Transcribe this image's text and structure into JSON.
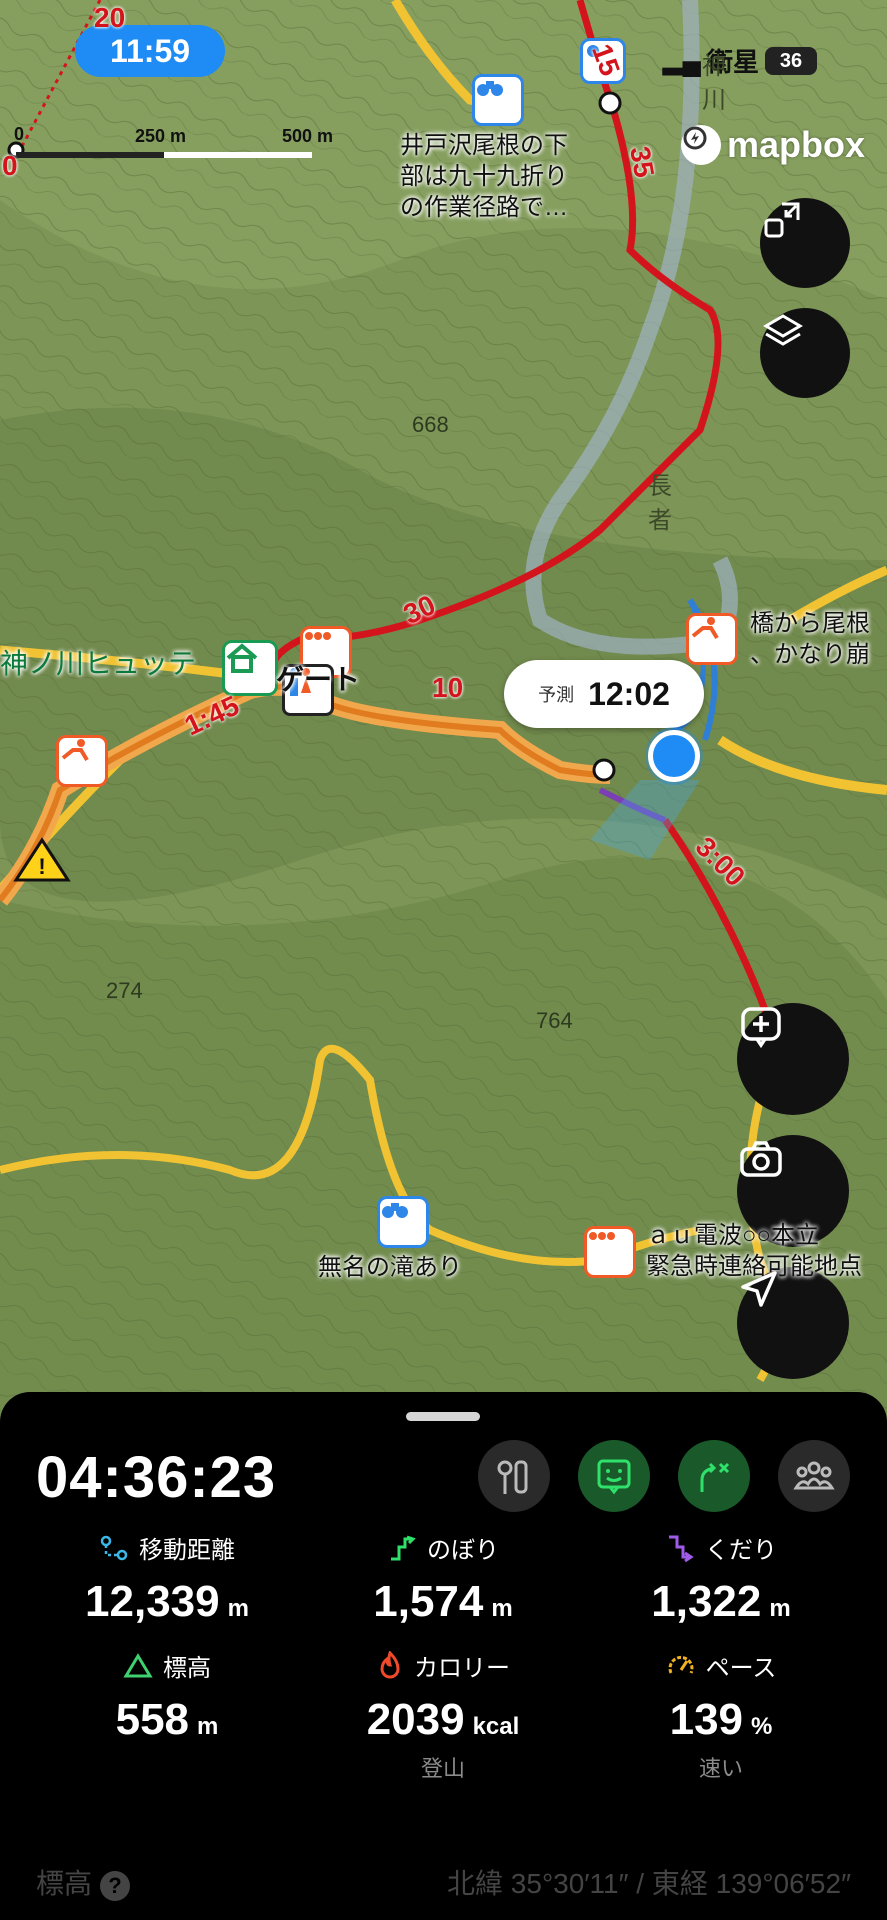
{
  "status_bar": {
    "time": "11:59",
    "carrier": "衛星",
    "battery": "36"
  },
  "scale": {
    "zero": "0",
    "mid": "250 m",
    "end": "500 m"
  },
  "attribution": "mapbox",
  "map": {
    "labels": {
      "idosawa": "井戸沢尾根の下\n部は九十九折り\nの作業径路で…",
      "hutte": "神ノ川ヒュッテ",
      "gate": "ゲート",
      "bridge": "橋から尾根\n、かなり崩",
      "waterfall": "無名の滝あり",
      "au": "ａｕ電波○○本立\n緊急時連絡可能地点"
    },
    "contour_labels": {
      "c668": "668",
      "c274": "274",
      "c764": "764",
      "river": "神\n川",
      "naga": "長\n者"
    },
    "route_marks": {
      "m20": "20",
      "m0": "0",
      "m15": "15",
      "m35": "35",
      "m30": "30",
      "m10": "10",
      "m145": "1:45",
      "m300": "3:00"
    },
    "forecast": {
      "label": "予測",
      "time": "12:02"
    }
  },
  "panel": {
    "elapsed": "04:36:23",
    "stats": {
      "distance": {
        "label": "移動距離",
        "value": "12,339",
        "unit": "m"
      },
      "ascent": {
        "label": "のぼり",
        "value": "1,574",
        "unit": "m"
      },
      "descent": {
        "label": "くだり",
        "value": "1,322",
        "unit": "m"
      },
      "elevation": {
        "label": "標高",
        "value": "558",
        "unit": "m"
      },
      "calorie": {
        "label": "カロリー",
        "value": "2039",
        "unit": "kcal",
        "sub": "登山"
      },
      "pace": {
        "label": "ペース",
        "value": "139",
        "unit": "%",
        "sub": "速い"
      }
    },
    "bottom": {
      "label": "標高",
      "help": "?",
      "coords": "北緯 35°30′11″ / 東経 139°06′52″"
    }
  },
  "colors": {
    "route": "#d4141c",
    "trail": "#f1c332",
    "accent_blue": "#1e8cf4",
    "panel_bg": "#000000"
  }
}
